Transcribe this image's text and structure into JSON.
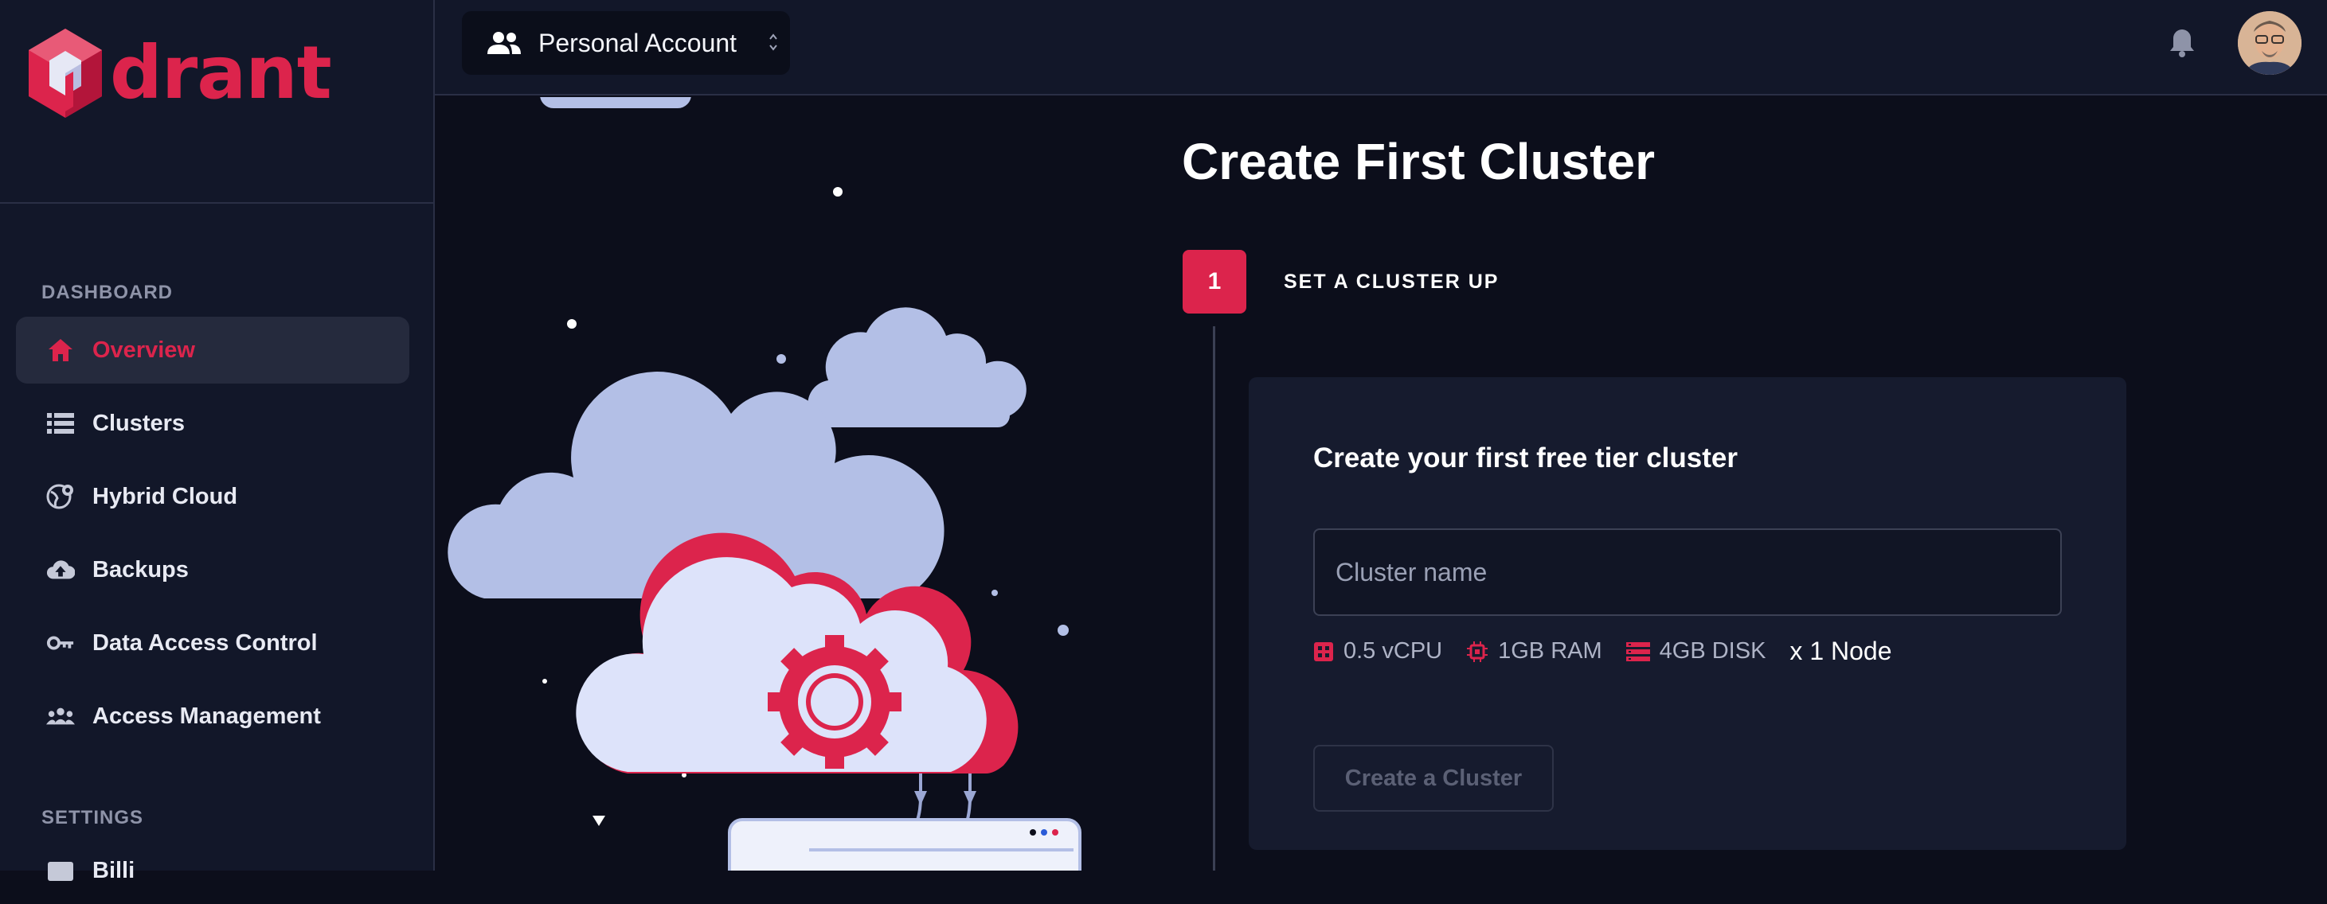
{
  "brand": {
    "logo_text": "drant",
    "accent": "#dc244c"
  },
  "sidebar": {
    "sections": [
      {
        "label": "DASHBOARD"
      },
      {
        "label": "SETTINGS"
      }
    ],
    "items": [
      {
        "label": "Overview",
        "icon": "home-icon",
        "active": true
      },
      {
        "label": "Clusters",
        "icon": "list-icon"
      },
      {
        "label": "Hybrid Cloud",
        "icon": "globe-settings-icon"
      },
      {
        "label": "Backups",
        "icon": "cloud-upload-icon"
      },
      {
        "label": "Data Access Control",
        "icon": "key-icon"
      },
      {
        "label": "Access Management",
        "icon": "people-icon"
      },
      {
        "label": "Billi",
        "icon": "billing-icon"
      }
    ]
  },
  "topbar": {
    "account": {
      "label": "Personal Account",
      "icon": "people-icon"
    },
    "notifications_icon": "bell-icon",
    "avatar_icon": "user-avatar"
  },
  "main": {
    "title": "Create First Cluster",
    "step": {
      "number": "1",
      "label": "SET A CLUSTER UP"
    },
    "card": {
      "title": "Create your first free tier cluster",
      "input_placeholder": "Cluster name",
      "input_value": "",
      "specs": [
        {
          "label": "0.5 vCPU",
          "icon": "cpu-icon"
        },
        {
          "label": "1GB RAM",
          "icon": "chip-icon"
        },
        {
          "label": "4GB DISK",
          "icon": "disk-icon"
        }
      ],
      "nodes": "x 1 Node",
      "button_label": "Create a Cluster",
      "button_disabled": true
    }
  }
}
